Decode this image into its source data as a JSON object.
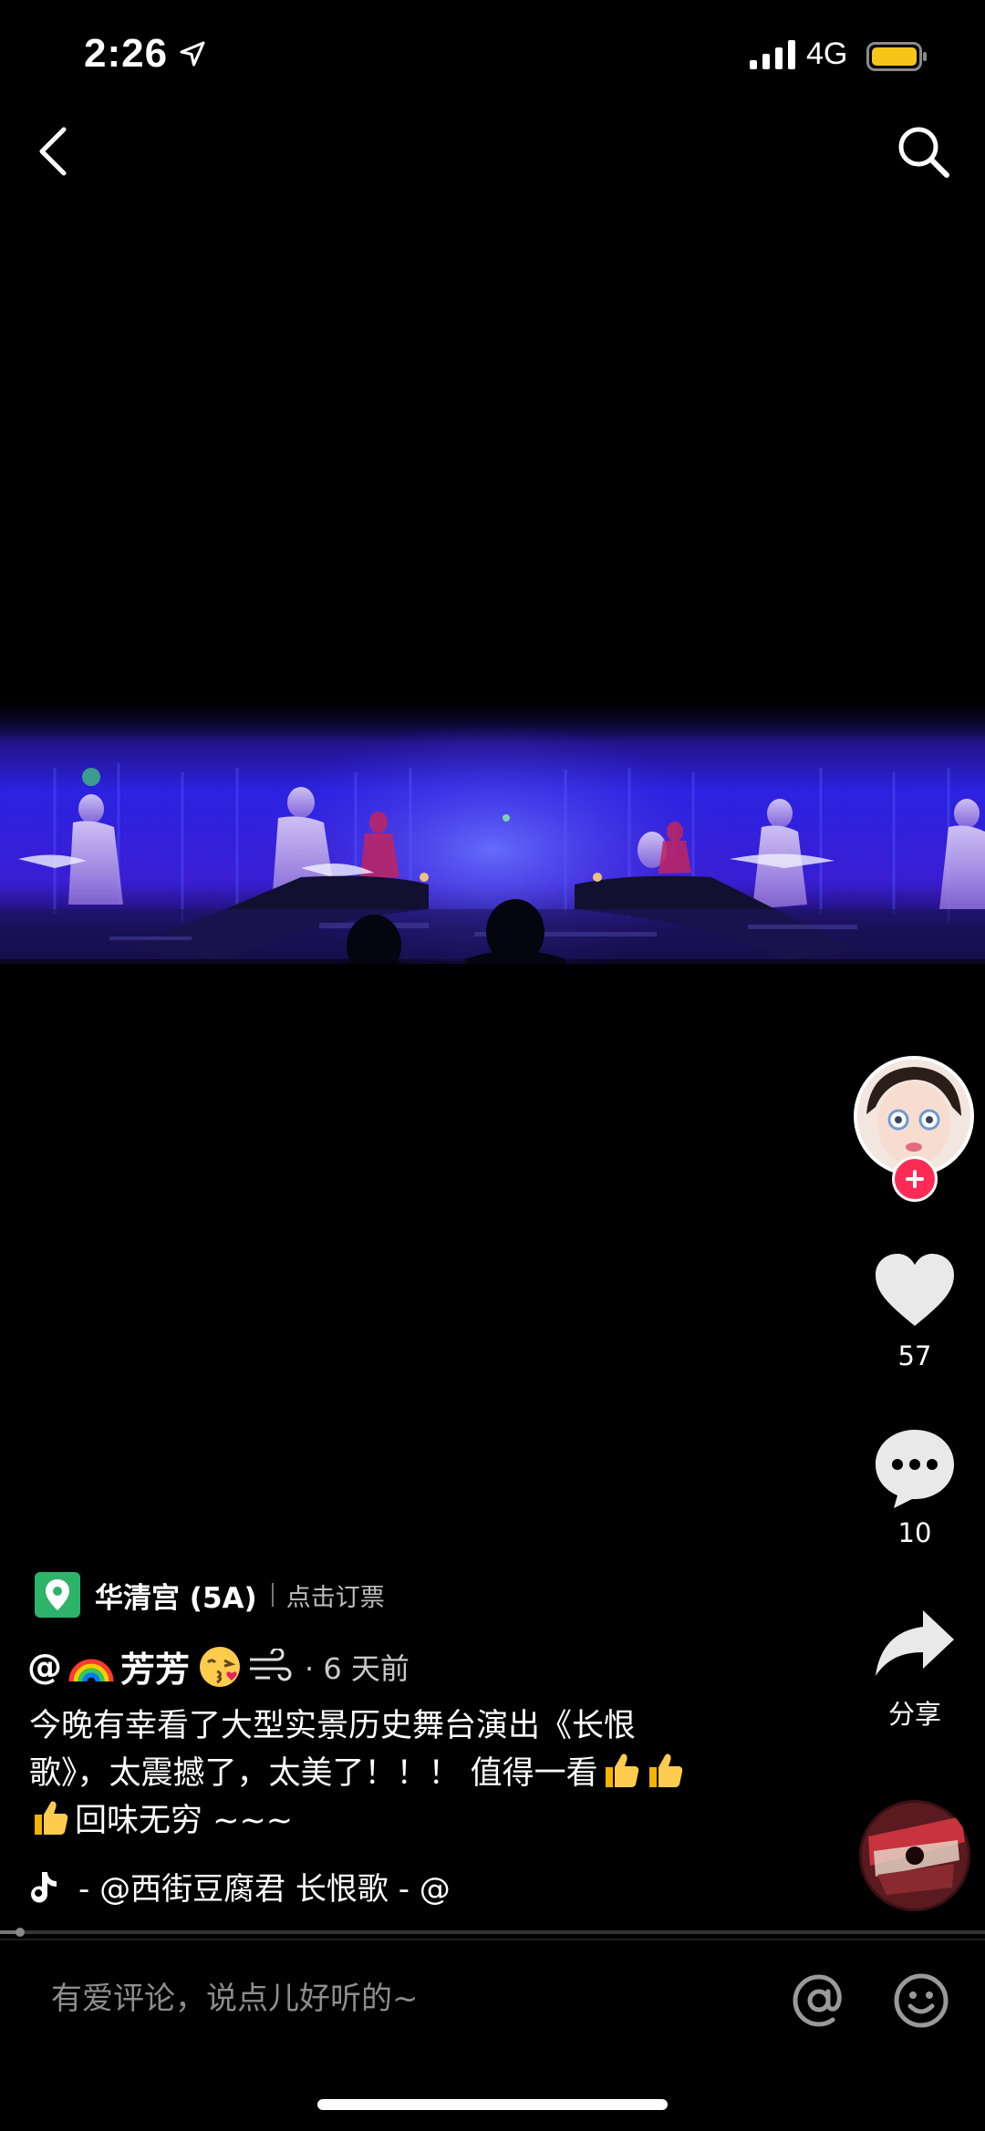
{
  "status_bar": {
    "time": "2:26",
    "network": "4G",
    "battery_color": "#f5c518"
  },
  "nav": {
    "back_icon": "chevron-left-icon",
    "search_icon": "search-icon"
  },
  "rail": {
    "like_count": "57",
    "comment_count": "10",
    "share_label": "分享",
    "follow_color": "#fe2c55"
  },
  "location": {
    "name": "华清宫 (5A)",
    "action": "点击订票",
    "icon_color": "#2db36a"
  },
  "author": {
    "prefix": "@",
    "name": "芳芳",
    "time": "· 6 天前"
  },
  "caption": {
    "line1": "今晚有幸看了大型实景历史舞台演出《长恨",
    "line2": "歌》，太震撼了，太美了！！！ 值得一看",
    "line3": "回味无穷 ~~~"
  },
  "music": {
    "text": "- @西街豆腐君    长恨歌 - @"
  },
  "playback": {
    "progress_fraction": 0.02
  },
  "comment_bar": {
    "placeholder": "有爱评论，说点儿好听的~"
  }
}
